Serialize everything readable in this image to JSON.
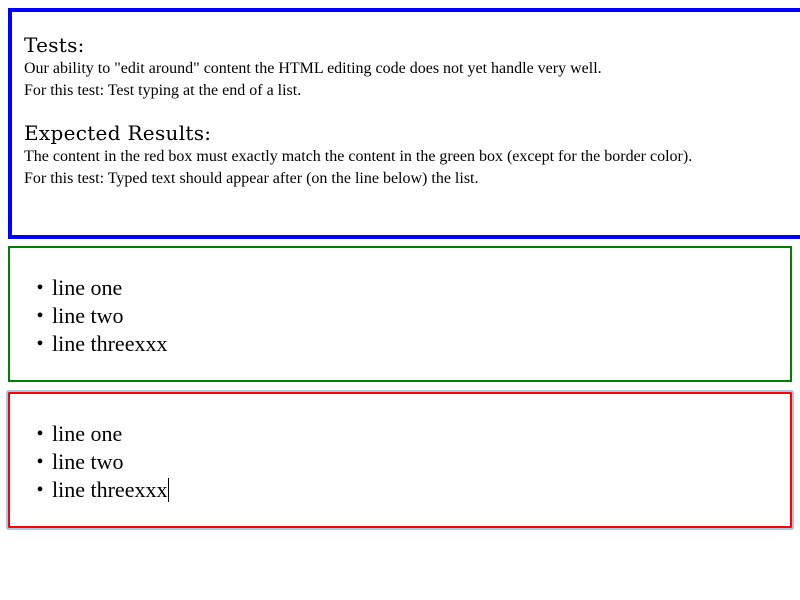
{
  "description": {
    "tests_heading": "Tests:",
    "tests_line1": "Our ability to \"edit around\" content the HTML editing code does not yet handle very well.",
    "tests_line2": "For this test: Test typing at the end of a list.",
    "expected_heading": "Expected Results:",
    "expected_line1": "The content in the red box must exactly match the content in the green box (except for the border color).",
    "expected_line2": "For this test: Typed text should appear after (on the line below) the list."
  },
  "expected_box": {
    "border_color": "#008000",
    "items": [
      "line one",
      "line two",
      "line threexxx"
    ]
  },
  "actual_box": {
    "border_color": "#ff0000",
    "items": [
      "line one",
      "line two",
      "line threexxx"
    ]
  },
  "bullet_glyph": "•",
  "colors": {
    "description_border": "#0000ff",
    "focus_glow": "#a8c8e8"
  }
}
